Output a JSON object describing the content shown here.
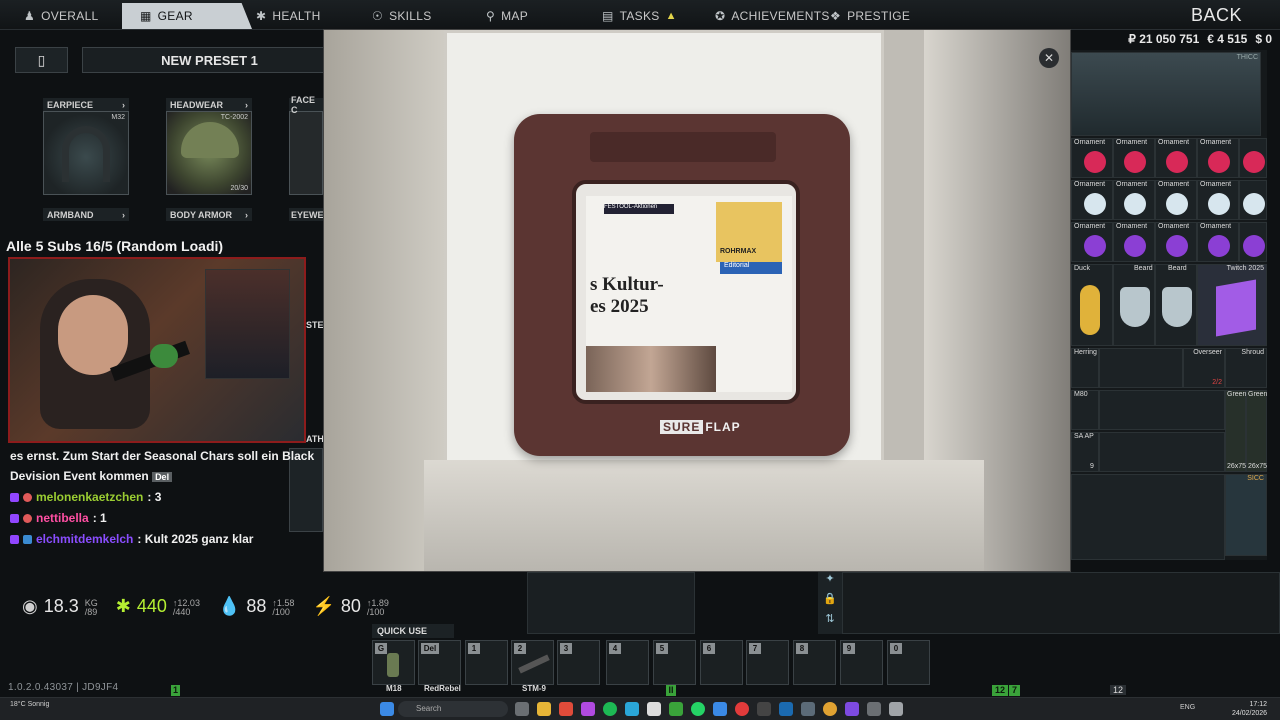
{
  "nav": {
    "tabs": [
      {
        "label": "OVERALL",
        "icon": "person-icon"
      },
      {
        "label": "GEAR",
        "icon": "vest-icon"
      },
      {
        "label": "HEALTH",
        "icon": "health-icon"
      },
      {
        "label": "SKILLS",
        "icon": "skills-icon"
      },
      {
        "label": "MAP",
        "icon": "map-pin-icon"
      },
      {
        "label": "TASKS",
        "icon": "tasks-icon"
      },
      {
        "label": "ACHIEVEMENTS",
        "icon": "achievements-icon"
      },
      {
        "label": "PRESTIGE",
        "icon": "prestige-icon"
      }
    ],
    "active_tab": "GEAR",
    "back_label": "BACK"
  },
  "money": {
    "roubles": "₽ 21 050 751",
    "euros": "€ 4 515",
    "dollars": "$ 0"
  },
  "gear": {
    "preset_name": "NEW PRESET 1",
    "slots": [
      {
        "label": "EARPIECE",
        "item_tag": "M32"
      },
      {
        "label": "HEADWEAR",
        "item_tag": "TC-2002",
        "durability": "20/30"
      },
      {
        "label": "FACE C",
        "item_tag": ""
      },
      {
        "label": "ARMBAND"
      },
      {
        "label": "BODY ARMOR"
      },
      {
        "label": "EYEWEA"
      },
      {
        "label": "STE"
      },
      {
        "label": "ATH"
      }
    ]
  },
  "stream": {
    "subs_title": "Alle 5 Subs 16/5   (Random Loadi)",
    "chat_message": "es ernst. Zum Start der Seasonal Chars soll ein Black Devision Event kommen",
    "delete_label": "Del",
    "chat": [
      {
        "user": "melonenkaetzchen",
        "text": ": 3",
        "color": "#9acd32"
      },
      {
        "user": "nettibella",
        "text": ": 1",
        "color": "#ff4fa3"
      },
      {
        "user": "elchmitdemkelch",
        "text": ": Kult 2025 ganz klar",
        "color": "#8a4dff"
      }
    ]
  },
  "stats": {
    "weight": {
      "value": "18.3",
      "unit": "KG",
      "max": "/89"
    },
    "health": {
      "value": "440",
      "max": "/440",
      "delta": "↑12.03"
    },
    "hydration": {
      "value": "88",
      "max": "/100",
      "delta": "↑1.58"
    },
    "energy": {
      "value": "80",
      "max": "/100",
      "delta": "↑1.89"
    }
  },
  "stash": {
    "top_label": "THICC",
    "ornament_label": "Ornament",
    "items": [
      "Duck",
      "Beard",
      "Beard",
      "Twitch 2025",
      "Herring",
      "Overseer",
      "Shroud",
      "M80",
      "Green",
      "Green",
      "SA AP",
      "26x75",
      "26x75",
      "SICC"
    ],
    "ammo_count_1": "9",
    "red_count": "2/2"
  },
  "quick_use": {
    "label": "QUICK USE",
    "slots": [
      {
        "key": "G",
        "name": "M18"
      },
      {
        "key": "Del",
        "name": "RedRebel"
      },
      {
        "key": "1",
        "name": ""
      },
      {
        "key": "2",
        "name": "STM-9"
      },
      {
        "key": "3",
        "name": ""
      },
      {
        "key": "4",
        "name": ""
      },
      {
        "key": "5",
        "name": ""
      },
      {
        "key": "6",
        "name": ""
      },
      {
        "key": "7",
        "name": ""
      },
      {
        "key": "8",
        "name": ""
      },
      {
        "key": "9",
        "name": ""
      },
      {
        "key": "0",
        "name": ""
      }
    ]
  },
  "footer": {
    "version": "1.0.2.0.43037 | JD9JF4",
    "left_flag": "1",
    "center_flag": "II",
    "right_counter_a": "12",
    "right_counter_b": "7",
    "players": "12",
    "time": "17:12",
    "date": "24/02/2026",
    "lang": "ENG",
    "weather": "18°C Sonnig"
  },
  "photo": {
    "brand_left": "SURE",
    "brand_right": "FLAP",
    "newspaper_headline": "s Kultur-\nes 2025",
    "newspaper_section": "Editorial",
    "newspaper_tag": "FESTOOL-Aktionen",
    "ad_text": "ROHRMAX"
  }
}
